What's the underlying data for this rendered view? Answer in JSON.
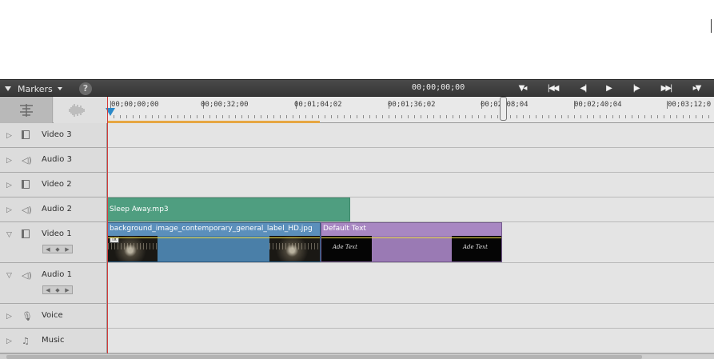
{
  "header": {
    "markers_label": "Markers",
    "help": "?",
    "timecode": "00;00;00;00",
    "transport": [
      {
        "name": "goto-start-marker",
        "glyph": "▼◂"
      },
      {
        "name": "goto-previous-edit",
        "glyph": "|◀◀"
      },
      {
        "name": "step-back",
        "glyph": "◀|"
      },
      {
        "name": "play",
        "glyph": "▶"
      },
      {
        "name": "step-forward",
        "glyph": "|▶"
      },
      {
        "name": "goto-next-edit",
        "glyph": "▶▶|"
      },
      {
        "name": "goto-end-marker",
        "glyph": "▸▼"
      }
    ]
  },
  "ruler": {
    "labels": [
      "00;00;00;00",
      "00;00;32;00",
      "00;01;04;02",
      "00;01;36;02",
      "00;02;08;04",
      "00;02;40;04",
      "00;03;12;0"
    ]
  },
  "tracks": [
    {
      "name": "Video 3",
      "type": "video",
      "expanded": false
    },
    {
      "name": "Audio 3",
      "type": "audio",
      "expanded": false
    },
    {
      "name": "Video 2",
      "type": "video",
      "expanded": false
    },
    {
      "name": "Audio 2",
      "type": "audio",
      "expanded": false
    },
    {
      "name": "Video 1",
      "type": "video",
      "expanded": true
    },
    {
      "name": "Audio 1",
      "type": "audio",
      "expanded": true
    },
    {
      "name": "Voice",
      "type": "voice",
      "expanded": false
    },
    {
      "name": "Music",
      "type": "music",
      "expanded": false
    }
  ],
  "clips": {
    "audio2": "Sleep Away.mp3",
    "background": "background_image_contemporary_general_label_HD.jpg",
    "text": "Default Text",
    "thumb_text": "Ade Text"
  },
  "colors": {
    "audio_clip": "#4f9e80",
    "video_clip": "#4a7fa8",
    "title_clip": "#9a7ab4",
    "playhead": "#d23a3a",
    "work_area": "#e6a642"
  }
}
